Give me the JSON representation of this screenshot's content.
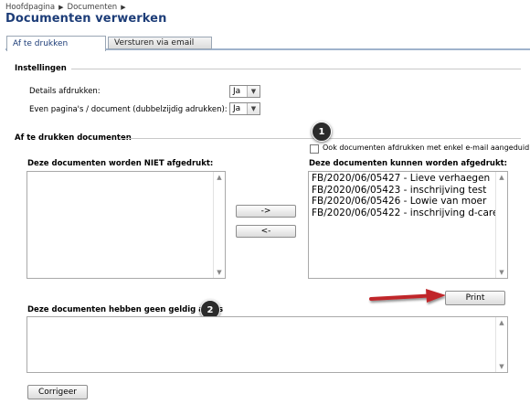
{
  "breadcrumb": {
    "items": [
      "Hoofdpagina",
      "Documenten"
    ]
  },
  "page_title": "Documenten verwerken",
  "tabs": [
    {
      "label": "Af te drukken"
    },
    {
      "label": "Versturen via email"
    }
  ],
  "instellingen": {
    "title": "Instellingen",
    "details_label": "Details afdrukken:",
    "details_value": "Ja",
    "even_label": "Even pagina's / document (dubbelzijdig adrukken):",
    "even_value": "Ja"
  },
  "print_section": {
    "title": "Af te drukken documenten",
    "email_checkbox_label": "Ook documenten afdrukken met enkel e-mail aangeduid",
    "not_printed_title": "Deze documenten worden NIET afgedrukt:",
    "printable_title": "Deze documenten kunnen worden afgedrukt:",
    "printable_items": [
      "FB/2020/06/05427 - Lieve verhaegen",
      "FB/2020/06/05423 - inschrijving test",
      "FB/2020/06/05426 - Lowie van moer",
      "FB/2020/06/05422 - inschrijving d-care"
    ],
    "move_right_label": "->",
    "move_left_label": "<-",
    "print_label": "Print",
    "invalid_title": "Deze documenten hebben geen geldig adres",
    "correct_label": "Corrigeer"
  },
  "badges": [
    "1",
    "2"
  ],
  "colors": {
    "title": "#1d3d78",
    "arrow": "#c0282b",
    "badge": "#2b2b2b"
  },
  "icons": {
    "breadcrumb_separator": "triangle-right-icon",
    "select_arrow": "chevron-down-icon"
  }
}
